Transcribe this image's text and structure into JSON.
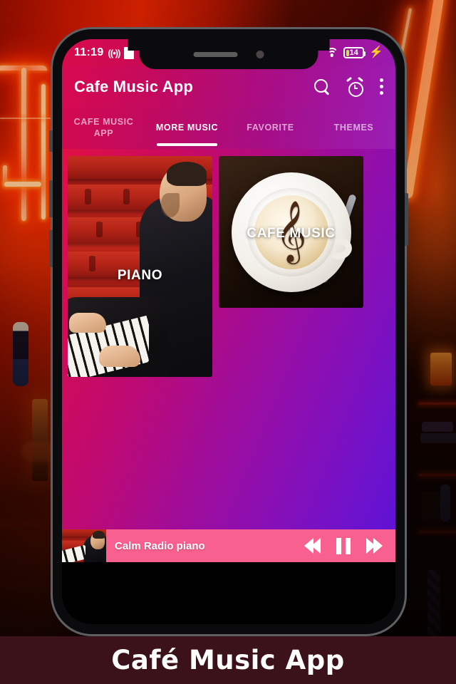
{
  "background": {
    "description": "neon-bar-scene"
  },
  "phone": {
    "statusbar": {
      "time": "11:19",
      "cast_icon": "((•))",
      "wifi_icon": "wifi-icon",
      "battery_level": "14",
      "charging_icon": "⚡"
    },
    "appbar": {
      "title": "Cafe Music App",
      "search_icon": "search-icon",
      "alarm_icon": "alarm-clock-icon",
      "more_icon": "overflow-menu-icon"
    },
    "tabs": [
      {
        "label": "CAFE MUSIC APP",
        "active": false
      },
      {
        "label": "MORE MUSIC",
        "active": true
      },
      {
        "label": "FAVORITE",
        "active": false
      },
      {
        "label": "THEMES",
        "active": false
      }
    ],
    "cards": [
      {
        "label": "PIANO",
        "art": "pianist-in-red-auditorium"
      },
      {
        "label": "CAFE MUSIC",
        "art": "latte-art-treble-clef"
      }
    ],
    "player": {
      "title": "Calm Radio piano",
      "prev_label": "previous-track",
      "pause_label": "pause",
      "next_label": "next-track"
    }
  },
  "footer": {
    "title": "Café Music App"
  },
  "colors": {
    "accent_pink": "#d8094f",
    "accent_purple": "#5a12d6",
    "player_bar": "#f8608f",
    "footer_bg": "#3b111a"
  }
}
